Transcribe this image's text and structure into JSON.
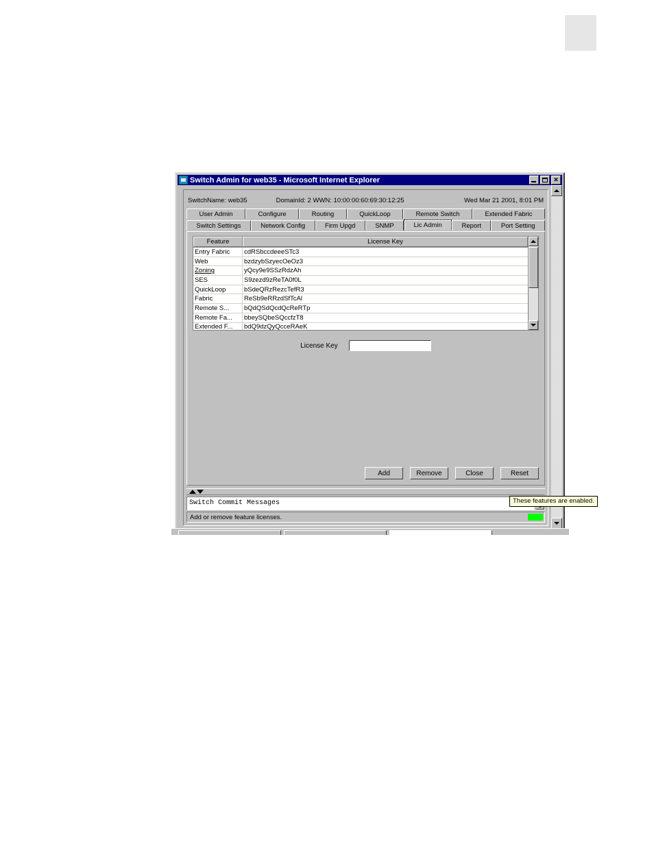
{
  "window": {
    "title": "Switch Admin for web35 - Microsoft Internet Explorer",
    "minimize_label": "Minimize",
    "maximize_label": "Maximize",
    "close_label": "✕"
  },
  "switch_header": {
    "switch_name": "SwitchName: web35",
    "domain_wwn": "DomainId: 2 WWN: 10:00:00:60:69:30:12:25",
    "datetime": "Wed Mar 21  2001, 8:01 PM"
  },
  "tabs": {
    "row1": [
      {
        "label": "User Admin",
        "selected": false
      },
      {
        "label": "Configure",
        "selected": false
      },
      {
        "label": "Routing",
        "selected": false
      },
      {
        "label": "QuickLoop",
        "selected": false
      },
      {
        "label": "Remote Switch",
        "selected": false
      },
      {
        "label": "Extended Fabric",
        "selected": false
      }
    ],
    "row2": [
      {
        "label": "Switch Settings",
        "selected": false
      },
      {
        "label": "Network Config",
        "selected": false
      },
      {
        "label": "Firm Upgd",
        "selected": false
      },
      {
        "label": "SNMP",
        "selected": false
      },
      {
        "label": "Lic Admin",
        "selected": true
      },
      {
        "label": "Report",
        "selected": false
      },
      {
        "label": "Port Setting",
        "selected": false
      }
    ]
  },
  "table": {
    "columns": [
      "Feature",
      "License Key"
    ],
    "rows": [
      {
        "feature": "Entry Fabric",
        "key": "cdRSbccdeeeSTc3",
        "underlined": false
      },
      {
        "feature": "Web",
        "key": "bzdzybSzyecOeOz3",
        "underlined": false
      },
      {
        "feature": "Zoning",
        "key": "yQcy9e9SSzRdzAh",
        "underlined": true
      },
      {
        "feature": "SES",
        "key": "S9zezd9zReTA0f0L",
        "underlined": false
      },
      {
        "feature": "QuickLoop",
        "key": "bSdeQRzRezcTefR3",
        "underlined": false
      },
      {
        "feature": "Fabric",
        "key": "ReSb9eRRzdSfTcAl",
        "underlined": false
      },
      {
        "feature": "Remote S...",
        "key": "bQdQSdQcdQcReRTp",
        "underlined": false
      },
      {
        "feature": "Remote Fa...",
        "key": "bbeySQbeSQccfzT8",
        "underlined": false
      },
      {
        "feature": "Extended F...",
        "key": "bdQ9dzQyQcceRAeK",
        "underlined": false
      }
    ]
  },
  "tooltip": {
    "text": "These features are enabled."
  },
  "license_field": {
    "label": "License Key",
    "value": "",
    "placeholder": ""
  },
  "buttons": [
    {
      "label": "Add"
    },
    {
      "label": "Remove"
    },
    {
      "label": "Close"
    },
    {
      "label": "Reset"
    }
  ],
  "message_pane": {
    "text": "Switch Commit Messages"
  },
  "statusbar": {
    "text": "Add or remove feature licenses.",
    "led_color": "#00ff00"
  },
  "colors": {
    "titlebar": "#000080",
    "face": "#c0c0c0",
    "tooltip_bg": "#ffffdc"
  }
}
